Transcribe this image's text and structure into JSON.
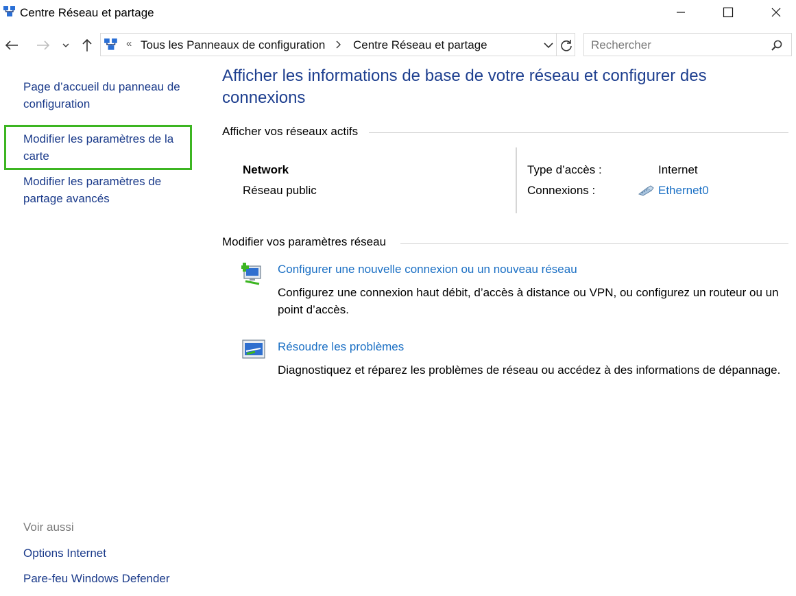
{
  "window": {
    "title": "Centre Réseau et partage",
    "app_icon": "network-center-icon"
  },
  "address": {
    "breadcrumbs": [
      "Tous les Panneaux de configuration",
      "Centre Réseau et partage"
    ],
    "overflow_glyph": "«"
  },
  "search": {
    "placeholder": "Rechercher"
  },
  "sidebar": {
    "home": "Page d’accueil du panneau de configuration",
    "adapter_settings": "Modifier les paramètres de la carte",
    "sharing_settings": "Modifier les paramètres de partage avancés",
    "see_also": "Voir aussi",
    "internet_options": "Options Internet",
    "firewall": "Pare-feu Windows Defender",
    "highlight_color": "#3cb521"
  },
  "main": {
    "title": "Afficher les informations de base de votre réseau et configurer des connexions",
    "active_networks_header": "Afficher vos réseaux actifs",
    "network": {
      "name": "Network",
      "type": "Réseau public",
      "access_label": "Type d’accès :",
      "access_value": "Internet",
      "connections_label": "Connexions :",
      "connection_value": "Ethernet0"
    },
    "change_settings_header": "Modifier vos paramètres réseau",
    "tasks": [
      {
        "link": "Configurer une nouvelle connexion ou un nouveau réseau",
        "description": "Configurez une connexion haut débit, d’accès à distance ou VPN, ou configurez un routeur ou un point d’accès."
      },
      {
        "link": "Résoudre les problèmes",
        "description": "Diagnostiquez et réparez les problèmes de réseau ou accédez à des informations de dépannage."
      }
    ]
  },
  "colors": {
    "title_blue": "#1e3f8f",
    "link_blue": "#1a6fc4",
    "nav_link": "#1a3a8a"
  }
}
